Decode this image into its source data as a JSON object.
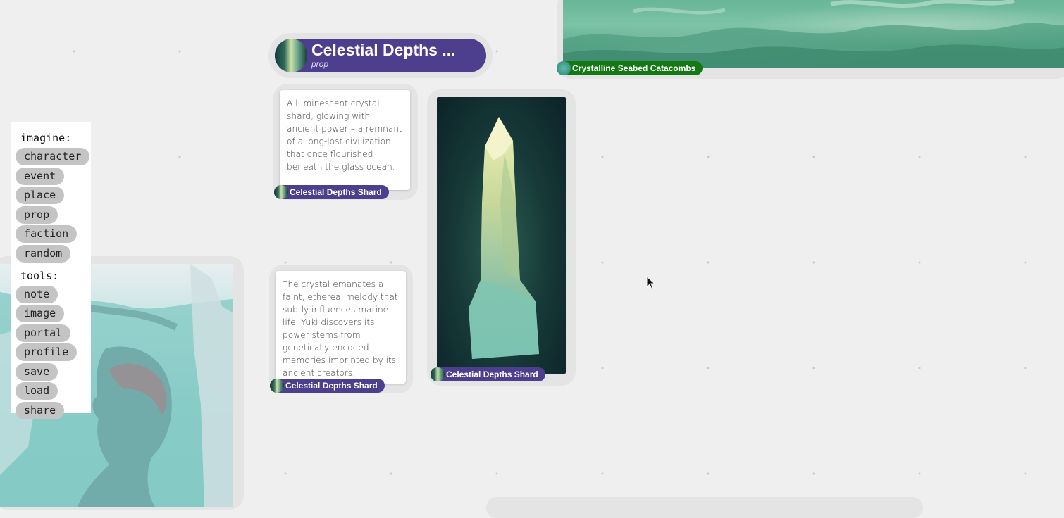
{
  "toolbar": {
    "imagine_heading": "imagine:",
    "imagine_buttons": [
      "character",
      "event",
      "place",
      "prop",
      "faction",
      "random"
    ],
    "tools_heading": "tools:",
    "tools_buttons": [
      "note",
      "image",
      "portal",
      "profile",
      "save",
      "load",
      "share"
    ]
  },
  "title_node": {
    "title": "Celestial Depths ...",
    "type": "prop"
  },
  "notes": [
    {
      "text": "A luminescent crystal shard, glowing with ancient power – a remnant of a long-lost civilization that once flourished beneath the glass ocean.",
      "label": "Celestial Depths Shard"
    },
    {
      "text": "The crystal emanates a faint, ethereal melody that subtly influences marine life. Yuki discovers its power stems from genetically encoded memories imprinted by its ancient creators.",
      "label": "Celestial Depths Shard"
    }
  ],
  "image_node": {
    "label": "Celestial Depths Shard"
  },
  "location_node": {
    "label": "Crystalline Seabed Catacombs"
  },
  "colors": {
    "prop_pill": "#4d3f8e",
    "place_pill": "#137a13",
    "canvas": "#efefef"
  }
}
